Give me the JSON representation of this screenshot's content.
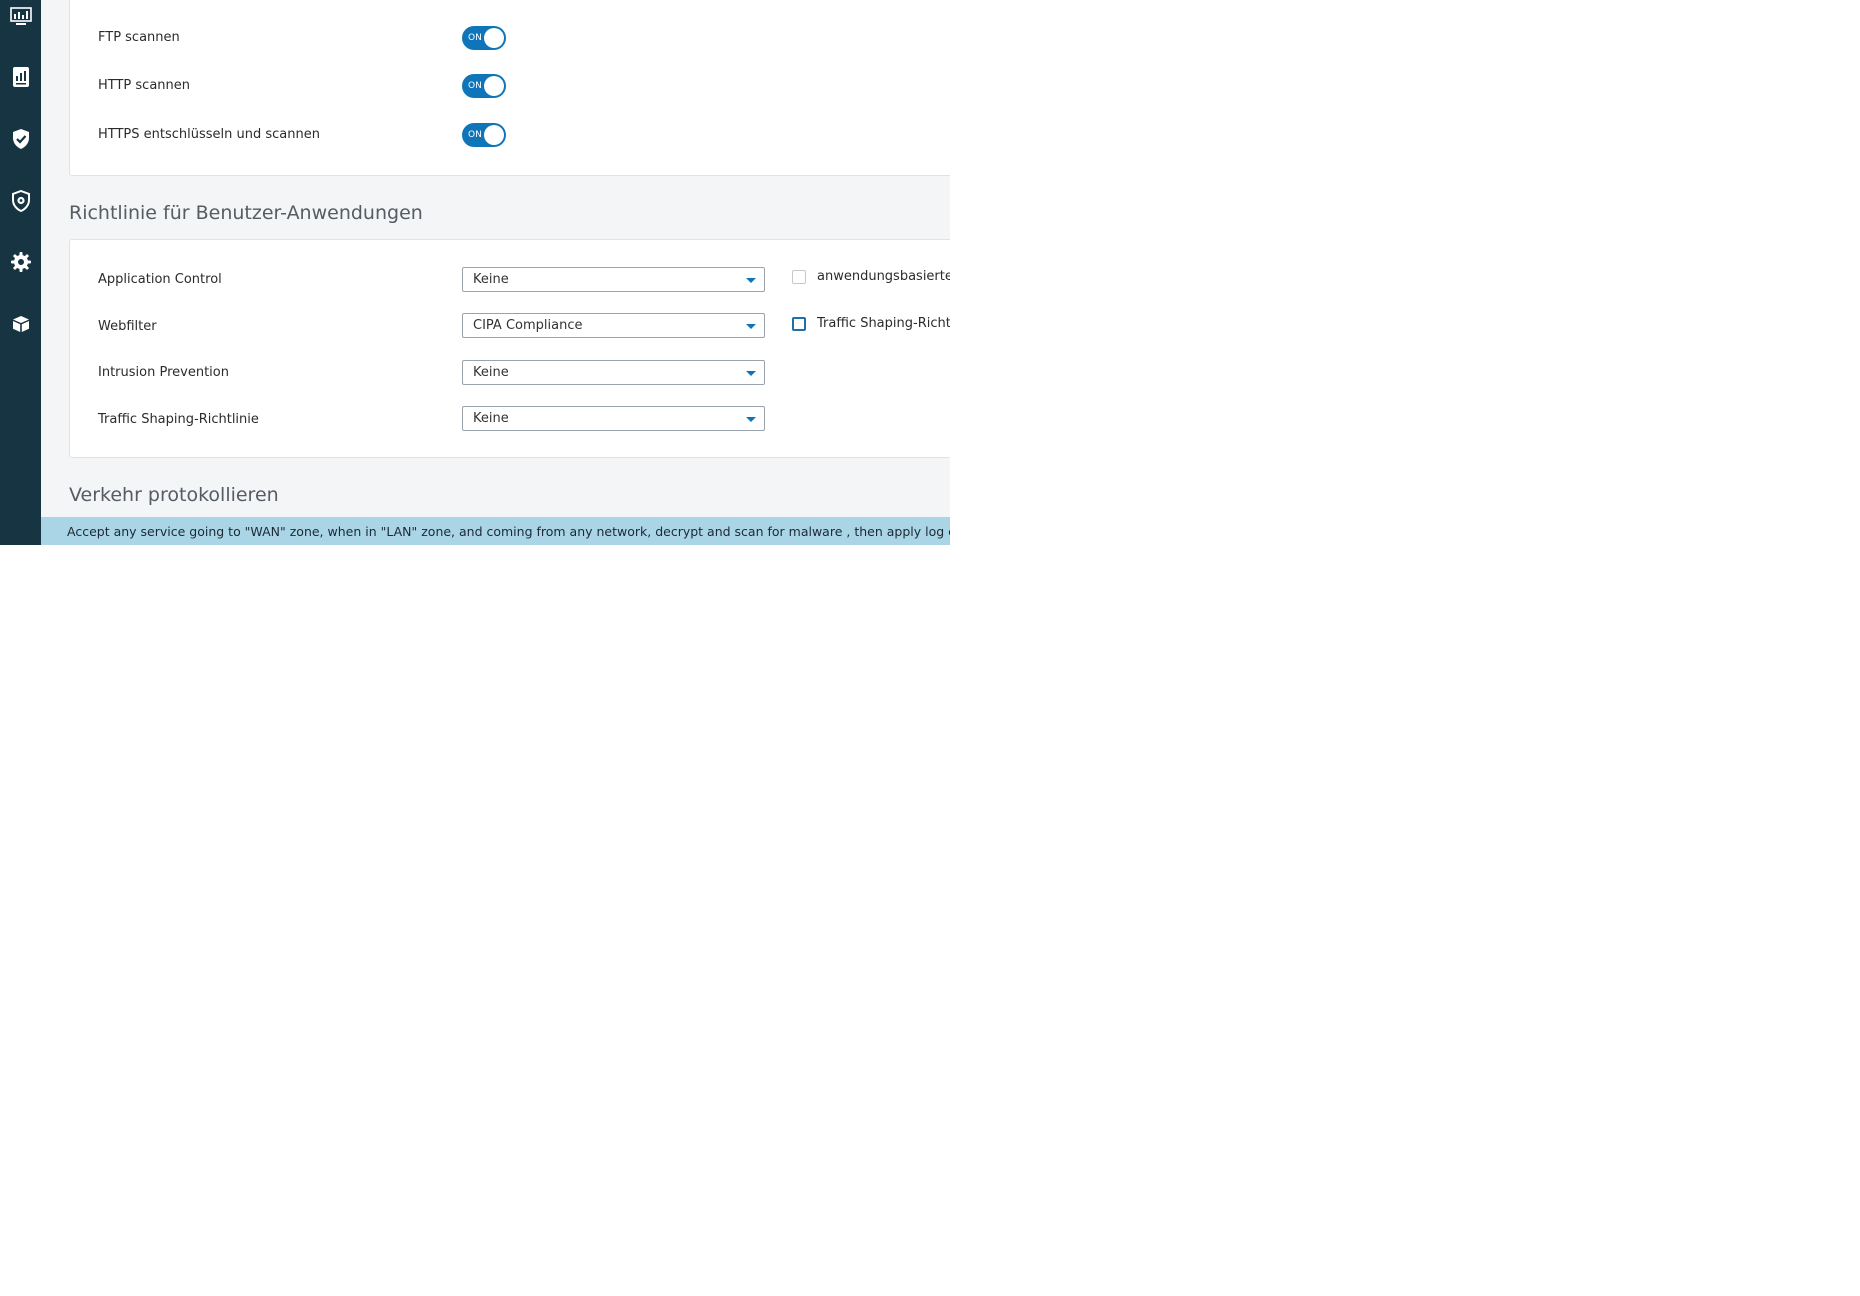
{
  "sidebar": {
    "icons": [
      {
        "name": "monitor-icon"
      },
      {
        "name": "reports-icon"
      },
      {
        "name": "shield-check-icon"
      },
      {
        "name": "shield-gear-icon"
      },
      {
        "name": "gear-icon"
      },
      {
        "name": "package-icon"
      }
    ]
  },
  "scan": {
    "rows": [
      {
        "label": "FTP scannen",
        "toggle": "ON"
      },
      {
        "label": "HTTP scannen",
        "toggle": "ON"
      },
      {
        "label": "HTTPS entschlüsseln und scannen",
        "toggle": "ON"
      }
    ]
  },
  "policy": {
    "title": "Richtlinie für Benutzer-Anwendungen",
    "rows": [
      {
        "label": "Application Control",
        "value": "Keine"
      },
      {
        "label": "Webfilter",
        "value": "CIPA Compliance"
      },
      {
        "label": "Intrusion Prevention",
        "value": "Keine"
      },
      {
        "label": "Traffic Shaping-Richtlinie",
        "value": "Keine"
      }
    ],
    "checkboxes": [
      {
        "label": "anwendungsbasierte Traffic Shapin"
      },
      {
        "label": "Traffic Shaping-Richtlinie gemäß W"
      }
    ]
  },
  "logging": {
    "title": "Verkehr protokollieren"
  },
  "summary": {
    "text": "Accept any service going to \"WAN\" zone, when in \"LAN\" zone, and coming from any network, decrypt and scan for malware , then apply log connections"
  },
  "colors": {
    "sidebar": "#173443",
    "accent": "#0f74b8",
    "summary_bar": "#a9d5e6"
  }
}
